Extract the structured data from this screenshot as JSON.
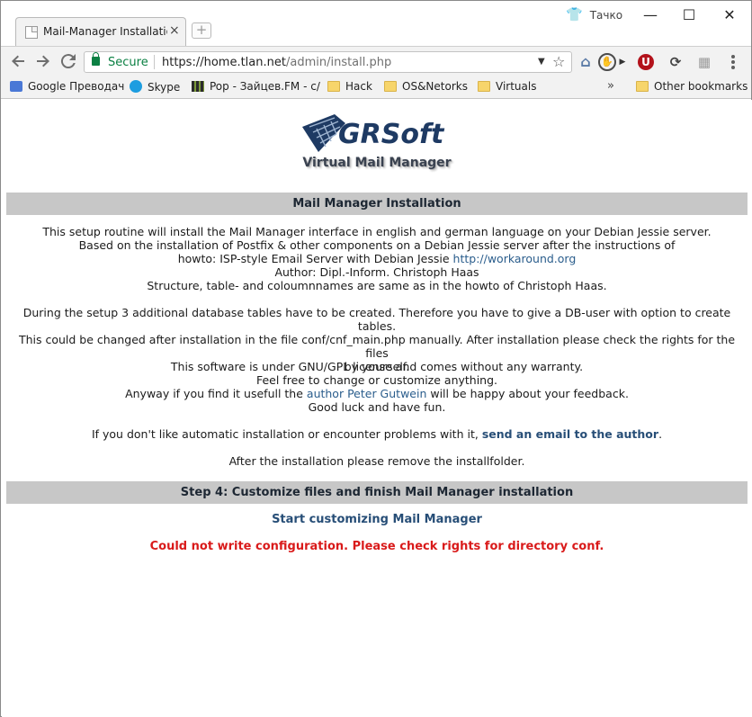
{
  "browser": {
    "tab_title": "Mail-Manager Installatio",
    "tab_close": "×",
    "new_tab": "+",
    "profile_name": "Тачко",
    "window_minimize": "—",
    "window_maximize": "☐",
    "window_close": "✕",
    "secure_label": "Secure",
    "url_host": "https://home.tlan.net",
    "url_path": "/admin/install.php",
    "bookmarks": [
      {
        "label": "Google Преводач",
        "icon": "translate-icon"
      },
      {
        "label": "Skype",
        "icon": "skype-icon"
      },
      {
        "label": "Pop - Зайцев.FM - с/",
        "icon": "radio-icon"
      },
      {
        "label": "Hack",
        "icon": "folder-icon"
      },
      {
        "label": "OS&Netorks",
        "icon": "folder-icon"
      },
      {
        "label": "Virtuals",
        "icon": "folder-icon"
      },
      {
        "label": "Other bookmarks",
        "icon": "folder-icon"
      }
    ],
    "bookmarks_overflow": "»"
  },
  "page": {
    "logo_text": "GRSoft",
    "subtitle": "Virtual Mail Manager",
    "install_header": "Mail Manager Installation",
    "intro": {
      "line1": "This setup routine will install the Mail Manager interface in english and german language on your Debian Jessie server.",
      "line2": "Based on the installation of Postfix & other components on a Debian Jessie server after the instructions of",
      "line3_prefix": "howto: ISP-style Email Server with Debian Jessie ",
      "line3_link": "http://workaround.org",
      "line4": "Author: Dipl.-Inform. Christoph Haas",
      "line5": "Structure, table- and coloumnnames are same as in the howto of Christoph Haas."
    },
    "setup": {
      "line1": "During the setup 3 additional database tables have to be created. Therefore you have to give a DB-user with option to create tables.",
      "line2": "This could be changed after installation in the file conf/cnf_main.php manually. After installation please check the rights for the files",
      "line3": "by yourself."
    },
    "license": {
      "line1": "This software is under GNU/GPL license and comes without any warranty.",
      "line2": "Feel free to change or customize anything.",
      "line3_prefix": "Anyway if you find it usefull the ",
      "line3_link": "author Peter Gutwein",
      "line3_suffix": " will be happy about your feedback.",
      "line4": "Good luck and have fun."
    },
    "contact": {
      "prefix": "If you don't like automatic installation or encounter problems with it, ",
      "link": "send an email to the author",
      "suffix": "."
    },
    "remove_note": "After the installation please remove the installfolder.",
    "step_header": "Step 4: Customize files and finish Mail Manager installation",
    "customize_link": "Start customizing Mail Manager",
    "error_message": "Could not write configuration. Please check rights for directory conf."
  },
  "colors": {
    "header_bar": "#c7c7c7",
    "link": "#2a5d8c",
    "error": "#d91a1a",
    "secure": "#0b8043"
  }
}
